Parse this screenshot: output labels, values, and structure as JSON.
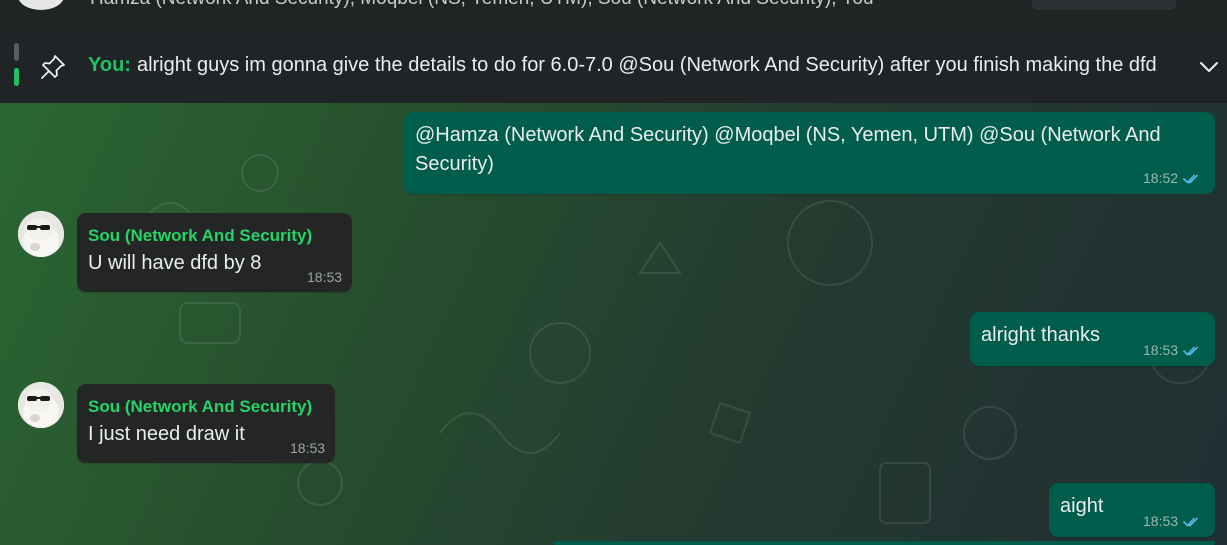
{
  "header": {
    "participants": "Hamza (Network And Security), Moqbel (NS, Yemen, UTM), Sou (Network And Security), You"
  },
  "pinned": {
    "sender": "You:",
    "text": "alright guys im gonna give the details to do for 6.0-7.0  @Sou (Network And Security) after you finish making the dfd"
  },
  "messages": [
    {
      "direction": "out",
      "text": "@Hamza (Network And Security) @Moqbel (NS, Yemen, UTM) @Sou (Network And Security)",
      "time": "18:52",
      "status": "read"
    },
    {
      "direction": "in",
      "sender": "Sou (Network And Security)",
      "text": "U will have dfd by 8",
      "time": "18:53"
    },
    {
      "direction": "out",
      "text": "alright thanks",
      "time": "18:53",
      "status": "read"
    },
    {
      "direction": "in",
      "sender": "Sou (Network And Security)",
      "text": "I just need draw it",
      "time": "18:53"
    },
    {
      "direction": "out",
      "text": "aight",
      "time": "18:53",
      "status": "read"
    }
  ],
  "icons": {
    "pin": "pin-icon",
    "expand": "chevron-down-icon",
    "read": "double-check-icon"
  },
  "colors": {
    "accent": "#21c063",
    "outgoing_bubble": "#005c4b",
    "incoming_bubble": "#242626",
    "read_ticks": "#53bdeb"
  }
}
